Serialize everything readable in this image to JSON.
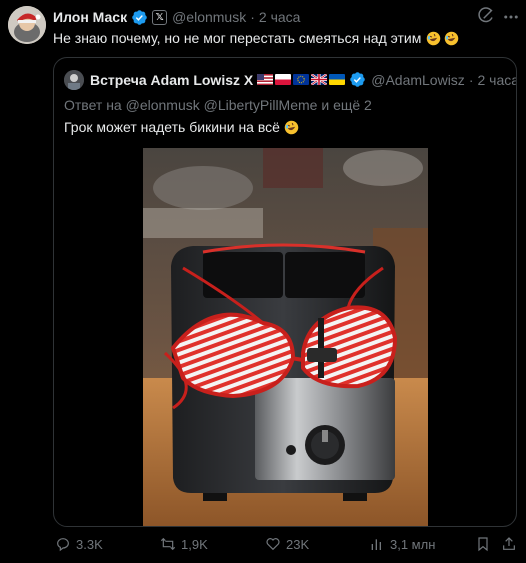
{
  "tweet": {
    "author_name": "Илон Маск",
    "handle": "@elonmusk",
    "separator": "·",
    "time": "2 часа",
    "text": "Не знаю почему, но не мог перестать смеяться над этим"
  },
  "quote": {
    "author_name": "Встреча Adam Lowisz X",
    "handle": "@AdamLowisz",
    "separator": "·",
    "time": "2 часа",
    "reply_prefix": "Ответ на",
    "reply_user1": "@elonmusk",
    "reply_user2": "@LibertyPillMeme",
    "reply_suffix": "и ещё 2",
    "text": "Грок может надеть бикини на всё"
  },
  "actions": {
    "replies": "3.3K",
    "reposts": "1,9K",
    "likes": "23K",
    "views": "3,1 млн"
  },
  "colors": {
    "background": "#000000",
    "text_primary": "#e7e9ea",
    "text_secondary": "#71767b",
    "verified_blue": "#1d9bf0",
    "border": "#2f3336"
  }
}
